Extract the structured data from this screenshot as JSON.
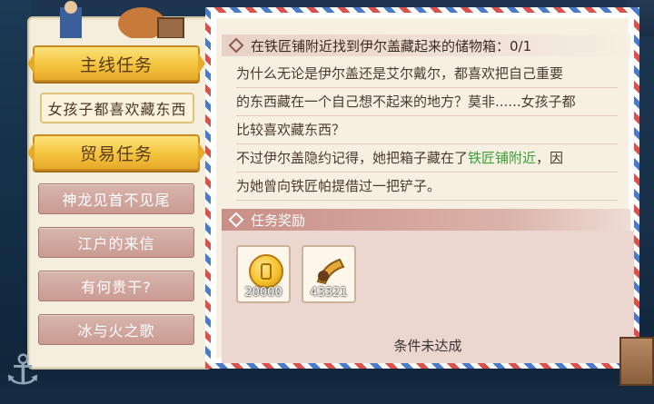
{
  "sidebar": {
    "main_quest": "主线任务",
    "active_quest": "女孩子都喜欢藏东西",
    "trade_quest": "贸易任务",
    "items": [
      {
        "label": "神龙见首不见尾"
      },
      {
        "label": "江户的来信"
      },
      {
        "label": "有何贵干?"
      },
      {
        "label": "冰与火之歌"
      }
    ]
  },
  "quest": {
    "title": "在铁匠铺附近找到伊尔盖藏起来的储物箱：0/1",
    "desc_1": "为什么无论是伊尔盖还是艾尔戴尔，都喜欢把自己重要",
    "desc_2": "的东西藏在一个自己想不起来的地方？莫非......女孩子都",
    "desc_3": "比较喜欢藏东西？",
    "desc_4a": "不过伊尔盖隐约记得，她把箱子藏在了",
    "desc_4hl": "铁匠铺附近",
    "desc_4b": "，因",
    "desc_5": "为她曾向铁匠帕提借过一把铲子。"
  },
  "rewards": {
    "header": "任务奖励",
    "items": [
      {
        "icon": "gold-coin-icon",
        "count": "20000"
      },
      {
        "icon": "horn-item-icon",
        "count": "43321"
      }
    ],
    "status": "条件未达成"
  },
  "colors": {
    "gold": "#f4c43d",
    "pink_button": "#c99b92",
    "highlight": "#3aa23a",
    "panel_bg": "#f6efe2"
  }
}
